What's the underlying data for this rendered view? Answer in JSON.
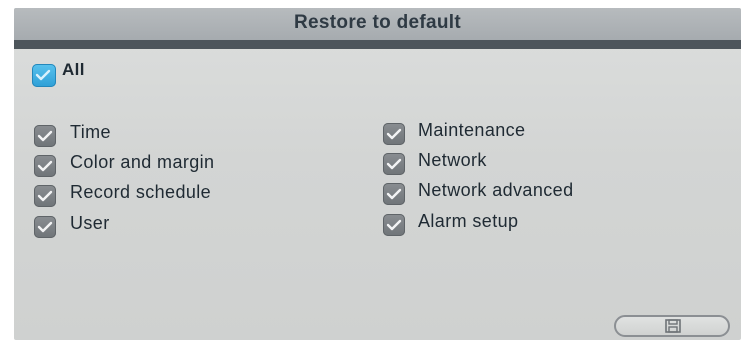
{
  "dialog": {
    "title": "Restore to default"
  },
  "all_option": {
    "label": "All",
    "checked": true,
    "color": "#3aa9e0"
  },
  "left_options": [
    {
      "label": "Time",
      "checked": true
    },
    {
      "label": "Color and margin",
      "checked": true
    },
    {
      "label": "Record schedule",
      "checked": true
    },
    {
      "label": "User",
      "checked": true
    }
  ],
  "right_options": [
    {
      "label": "Maintenance",
      "checked": true
    },
    {
      "label": "Network",
      "checked": true
    },
    {
      "label": "Network advanced",
      "checked": true
    },
    {
      "label": "Alarm setup",
      "checked": true
    }
  ],
  "footer": {
    "save_icon": "save-icon"
  }
}
